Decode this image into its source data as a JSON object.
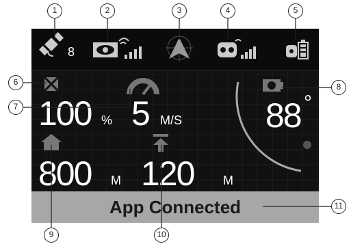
{
  "status": {
    "satellite_count": "8",
    "icons": [
      "satellite-signal-icon",
      "camera-image-signal-icon",
      "compass-arrow-icon",
      "remote-controller-signal-icon",
      "controller-battery-icon"
    ]
  },
  "flight": {
    "battery_value": "100",
    "battery_unit": "%",
    "speed_value": "5",
    "speed_unit": "M/S",
    "gimbal_value": "88",
    "gimbal_unit": "°",
    "distance_value": "800",
    "distance_unit": "M",
    "altitude_value": "120",
    "altitude_unit": "M"
  },
  "app_status": "App Connected",
  "callouts": [
    "1",
    "2",
    "3",
    "4",
    "5",
    "6",
    "7",
    "8",
    "9",
    "10",
    "11"
  ]
}
